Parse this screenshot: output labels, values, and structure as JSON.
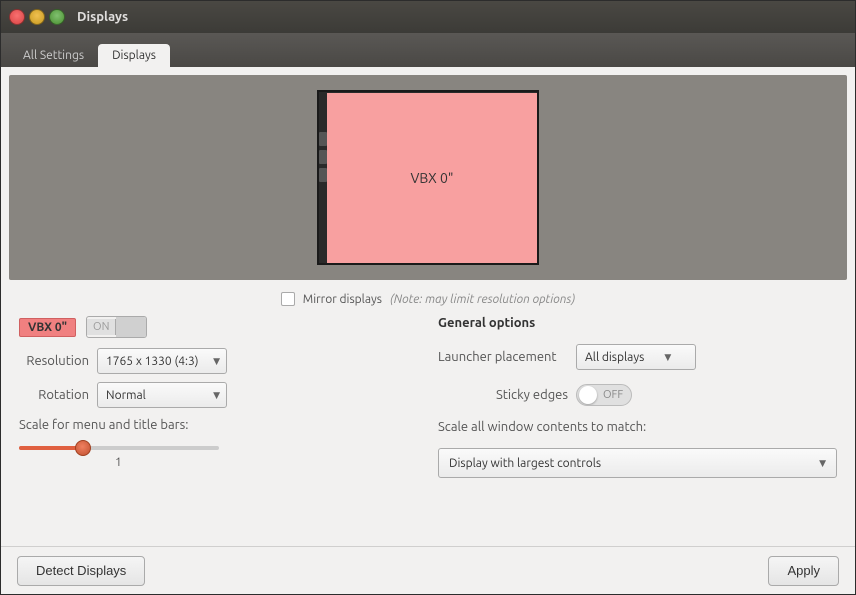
{
  "window": {
    "title": "Displays",
    "buttons": {
      "close": "×",
      "minimize": "−",
      "maximize": "+"
    }
  },
  "nav": {
    "tabs": [
      {
        "id": "all-settings",
        "label": "All Settings"
      },
      {
        "id": "displays",
        "label": "Displays",
        "active": true
      }
    ]
  },
  "display_preview": {
    "monitor_label": "VBX 0\""
  },
  "mirror": {
    "checkbox_checked": false,
    "label": "Mirror displays",
    "note": "(Note: may limit resolution options)"
  },
  "display_section": {
    "name_badge": "VBX 0\"",
    "toggle_on_label": "ON",
    "resolution_label": "Resolution",
    "resolution_value": "1765 x 1330 (4:3)",
    "rotation_label": "Rotation",
    "rotation_value": "Normal",
    "scale_label": "Scale for menu and title bars:",
    "scale_value": "1"
  },
  "general_options": {
    "title": "General options",
    "launcher_label": "Launcher placement",
    "launcher_value": "All displays",
    "sticky_label": "Sticky edges",
    "sticky_value": "OFF",
    "scale_window_label": "Scale all window contents to match:",
    "display_largest_label": "Display with largest controls"
  },
  "bottom_bar": {
    "detect_label": "Detect Displays",
    "apply_label": "Apply"
  }
}
